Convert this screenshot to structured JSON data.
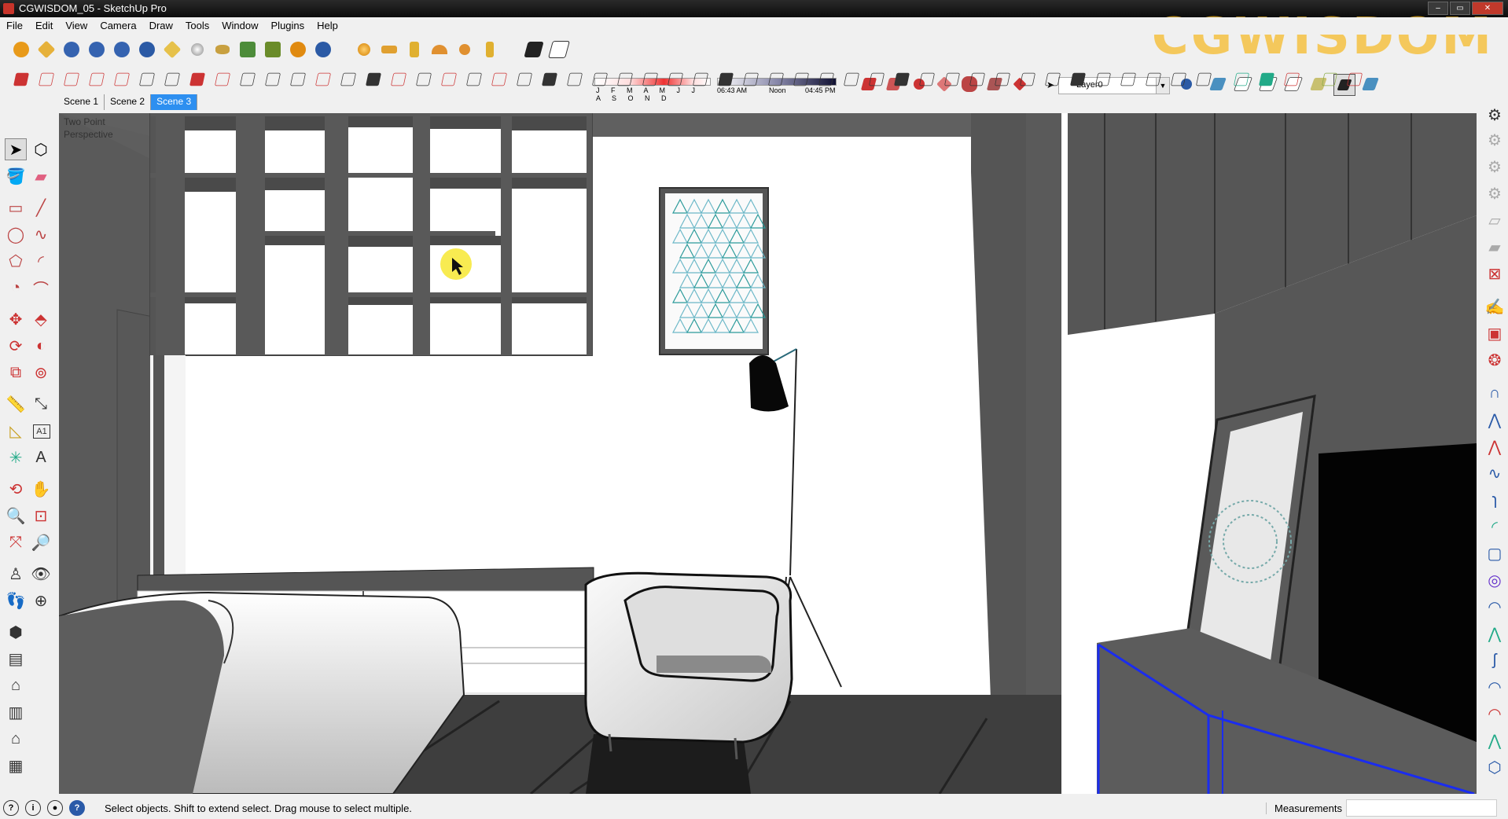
{
  "window": {
    "title": "CGWISDOM_05 - SketchUp Pro",
    "logo_text": "CGWISDOM"
  },
  "menu": [
    "File",
    "Edit",
    "View",
    "Camera",
    "Draw",
    "Tools",
    "Window",
    "Plugins",
    "Help"
  ],
  "toolbar": {
    "icons_row1": [
      "M-plugin-icon",
      "tag-icon",
      "R-plugin-icon",
      "RT-plugin-icon",
      "BR-plugin-icon",
      "question-icon",
      "label-icon",
      "sphere-icon",
      "bee-icon",
      "tree-icon",
      "tree2-icon",
      "target-icon",
      "pause-icon",
      "orange-sphere-icon",
      "platform-icon",
      "flag-icon",
      "dome-icon",
      "ball-icon",
      "pin-icon",
      "shadow-toggle-icon",
      "eraser-shadow-icon"
    ],
    "shadow_months": "J F M A M J J A S O N D",
    "time_start": "06:43 AM",
    "time_noon": "Noon",
    "time_end": "04:45 PM",
    "layer_value": "Layer0"
  },
  "scenes": [
    {
      "label": "Scene 1"
    },
    {
      "label": "Scene 2"
    },
    {
      "label": "Scene 3"
    }
  ],
  "active_scene": "Scene 3",
  "viewport": {
    "camera_label_line1": "Two Point",
    "camera_label_line2": "Perspective"
  },
  "status": {
    "message": "Select objects. Shift to extend select. Drag mouse to select multiple.",
    "measurements_label": "Measurements",
    "measurements_value": ""
  },
  "colors": {
    "titlebar": "#111111",
    "active_tab": "#2d8ff0",
    "logo": "#f5b923",
    "selection_blue": "#1a2cf0",
    "cursor_highlight": "#f7e733"
  }
}
